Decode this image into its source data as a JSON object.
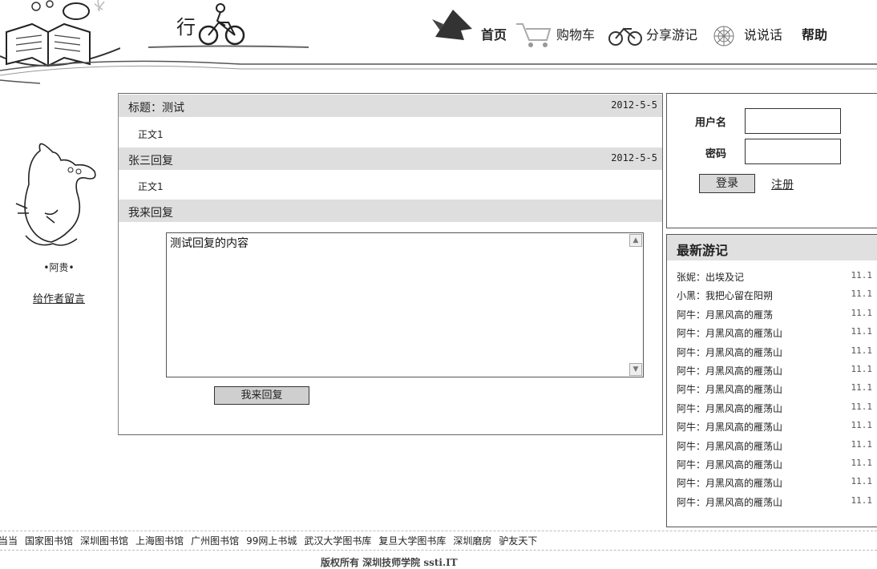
{
  "header": {
    "logo_char": "行",
    "nav": [
      {
        "label": "首页",
        "bold": true
      },
      {
        "label": "购物车",
        "bold": false
      },
      {
        "label": "分享游记",
        "bold": false
      },
      {
        "label": "说说话",
        "bold": false
      },
      {
        "label": "帮助",
        "bold": true
      }
    ]
  },
  "sidebar": {
    "author_name": "•阿贵•",
    "message_link": "给作者留言"
  },
  "post": {
    "title": "标题：测试",
    "date": "2012-5-5",
    "body": "正文1",
    "reply": {
      "author": "张三回复",
      "date": "2012-5-5",
      "body": "正文1"
    },
    "my_reply_label": "我来回复",
    "textarea_value": "测试回复的内容",
    "submit_label": "我来回复"
  },
  "login": {
    "username_label": "用户名",
    "password_label": "密码",
    "login_label": "登录",
    "register_label": "注册"
  },
  "latest": {
    "title": "最新游记",
    "items": [
      {
        "title": "张妮：出埃及记",
        "date": "11.1"
      },
      {
        "title": "小黑：我把心留在阳朔",
        "date": "11.1"
      },
      {
        "title": "阿牛：月黑风高的雁荡",
        "date": "11.1"
      },
      {
        "title": "阿牛：月黑风高的雁荡山",
        "date": "11.1"
      },
      {
        "title": "阿牛：月黑风高的雁荡山",
        "date": "11.1"
      },
      {
        "title": "阿牛：月黑风高的雁荡山",
        "date": "11.1"
      },
      {
        "title": "阿牛：月黑风高的雁荡山",
        "date": "11.1"
      },
      {
        "title": "阿牛：月黑风高的雁荡山",
        "date": "11.1"
      },
      {
        "title": "阿牛：月黑风高的雁荡山",
        "date": "11.1"
      },
      {
        "title": "阿牛：月黑风高的雁荡山",
        "date": "11.1"
      },
      {
        "title": "阿牛：月黑风高的雁荡山",
        "date": "11.1"
      },
      {
        "title": "阿牛：月黑风高的雁荡山",
        "date": "11.1"
      },
      {
        "title": "阿牛：月黑风高的雁荡山",
        "date": "11.1"
      }
    ]
  },
  "footer": {
    "links": [
      "当当",
      "国家图书馆",
      "深圳图书馆",
      "上海图书馆",
      "广州图书馆",
      "99网上书城",
      "武汉大学图书库",
      "复旦大学图书库",
      "深圳磨房",
      "驴友天下"
    ],
    "copyright": "版权所有 深圳技师学院 ssti.IT"
  }
}
